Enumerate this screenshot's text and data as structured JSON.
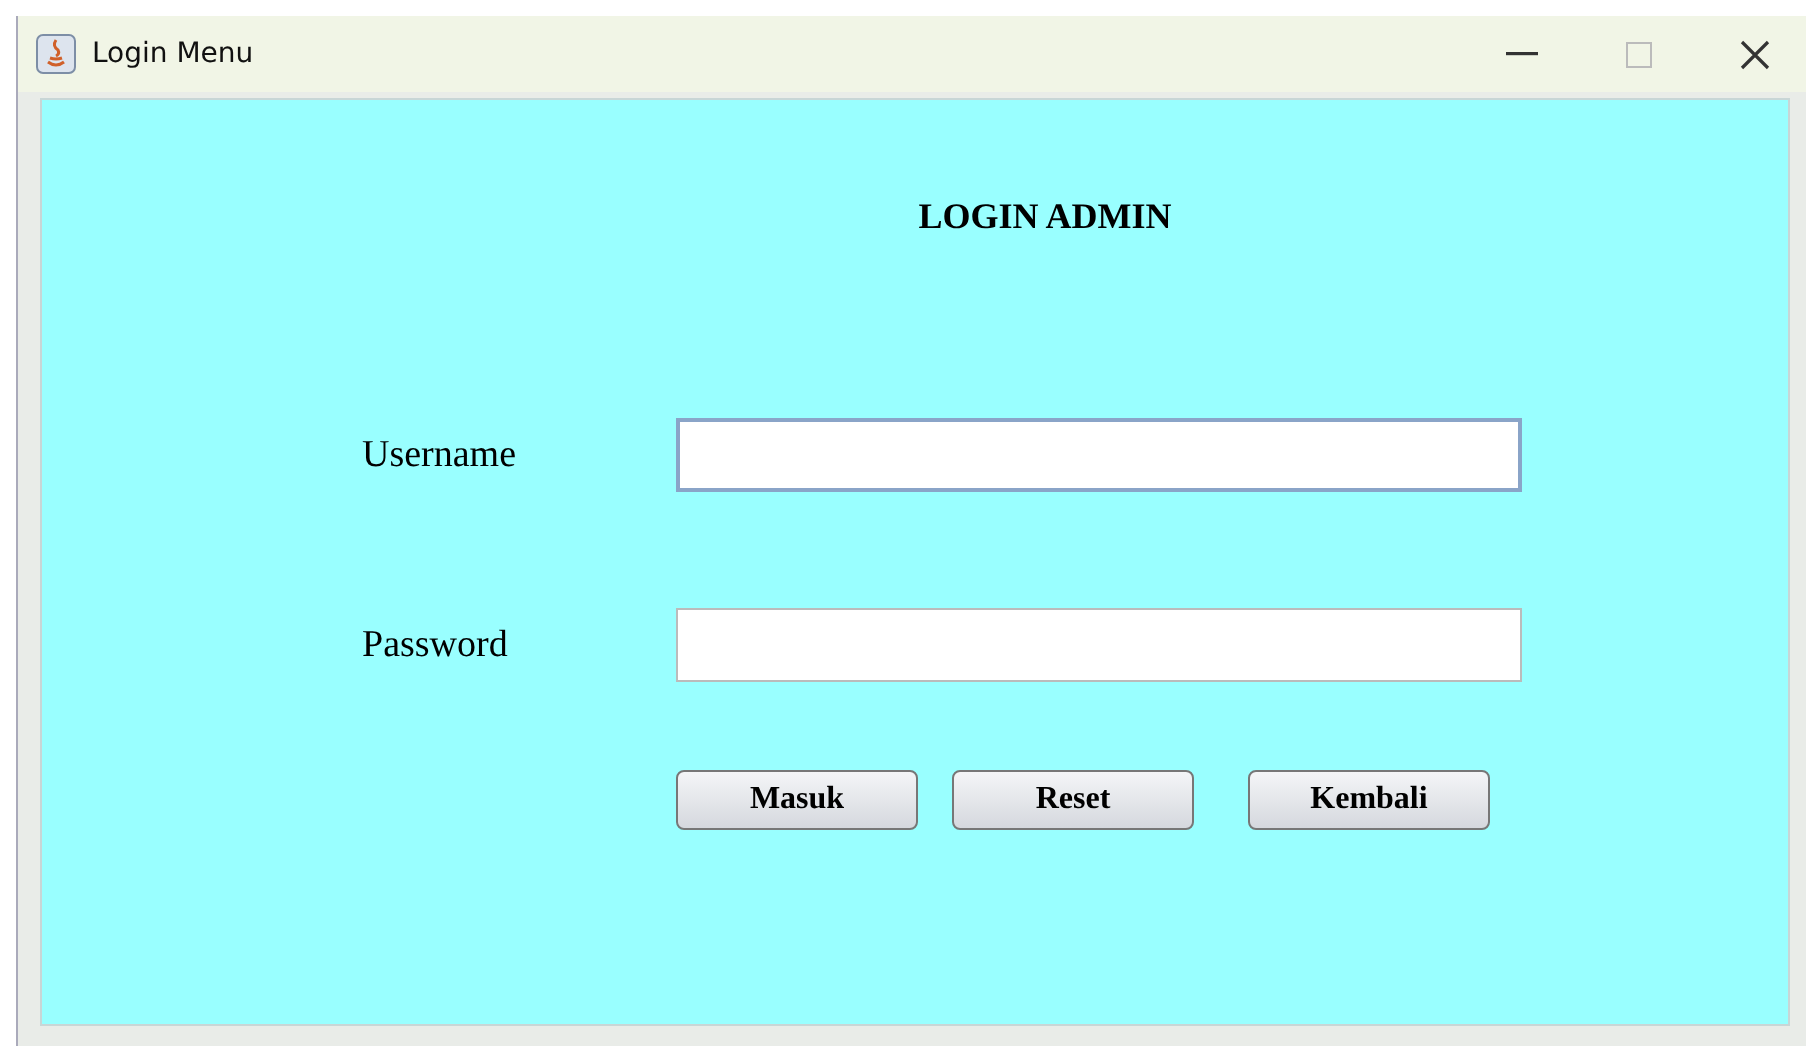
{
  "window": {
    "title": "Login Menu"
  },
  "heading": "LOGIN ADMIN",
  "fields": [
    {
      "label": "Username",
      "focused": true
    },
    {
      "label": "Password",
      "focused": false
    }
  ],
  "buttons": [
    "Masuk",
    "Reset",
    "Kembali"
  ]
}
